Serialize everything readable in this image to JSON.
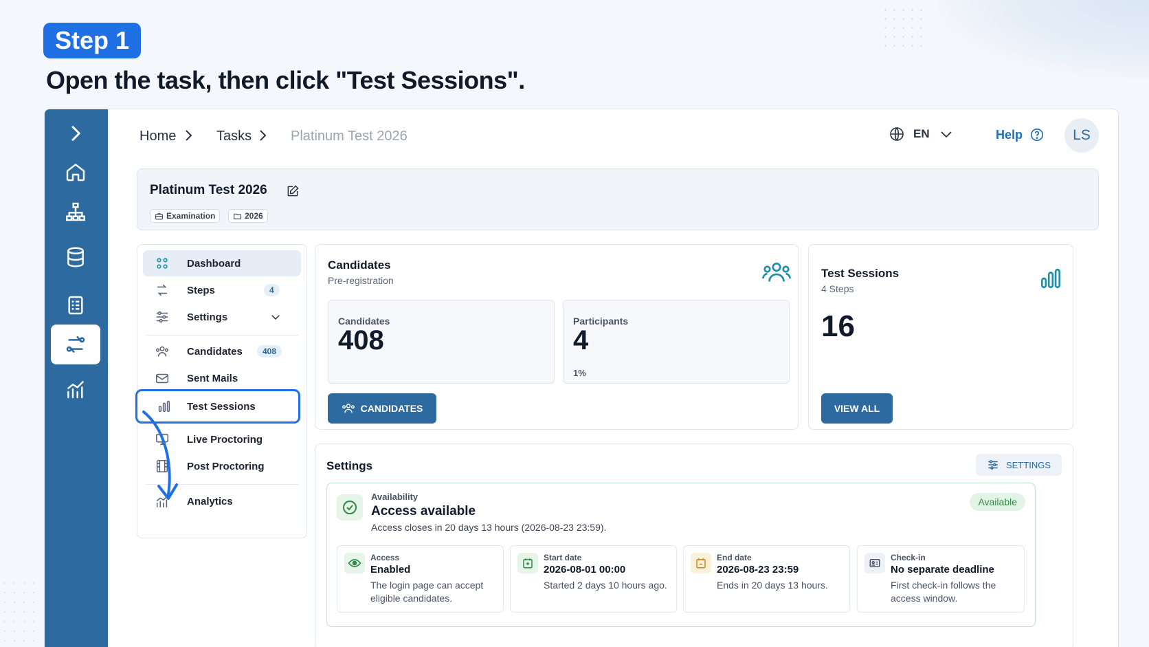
{
  "step_badge": "Step 1",
  "instruction": "Open the task, then click \"Test Sessions\".",
  "rail": {
    "icons": [
      "chevron-right-icon",
      "home-icon",
      "hierarchy-icon",
      "database-icon",
      "checklist-icon",
      "sessions-icon",
      "analytics-icon"
    ],
    "active_index": 5
  },
  "breadcrumb": {
    "home": "Home",
    "tasks": "Tasks",
    "current": "Platinum Test 2026"
  },
  "header": {
    "lang": "EN",
    "help": "Help",
    "avatar": "LS"
  },
  "task": {
    "title": "Platinum Test 2026",
    "tag_type": "Examination",
    "tag_year": "2026"
  },
  "sidebar": {
    "items": [
      {
        "label": "Dashboard",
        "icon": "dashboard-icon"
      },
      {
        "label": "Steps",
        "icon": "steps-icon",
        "badge": "4"
      },
      {
        "label": "Settings",
        "icon": "sliders-icon"
      },
      {
        "label": "Candidates",
        "icon": "users-icon",
        "badge": "408"
      },
      {
        "label": "Sent Mails",
        "icon": "mail-icon"
      },
      {
        "label": "Test Sessions",
        "icon": "bar-chart-icon"
      },
      {
        "label": "Live Proctoring",
        "icon": "monitor-icon"
      },
      {
        "label": "Post Proctoring",
        "icon": "film-icon"
      },
      {
        "label": "Analytics",
        "icon": "analytics-icon"
      }
    ]
  },
  "candidates_card": {
    "title": "Candidates",
    "subtitle": "Pre-registration",
    "stat1_label": "Candidates",
    "stat1_value": "408",
    "stat2_label": "Participants",
    "stat2_value": "4",
    "stat2_pct": "1%",
    "button": "CANDIDATES"
  },
  "sessions_card": {
    "title": "Test Sessions",
    "subtitle": "4 Steps",
    "value": "16",
    "button": "VIEW ALL"
  },
  "settings_card": {
    "title": "Settings",
    "button": "SETTINGS",
    "availability": {
      "small": "Availability",
      "title": "Access available",
      "desc": "Access closes in 20 days 13 hours (2026-08-23 23:59).",
      "pill": "Available"
    },
    "minis": [
      {
        "label": "Access",
        "value": "Enabled",
        "desc": "The login page can accept eligible candidates.",
        "color": "#2e8a44"
      },
      {
        "label": "Start date",
        "value": "2026-08-01 00:00",
        "desc": "Started 2 days 10 hours ago.",
        "color": "#2e8a44"
      },
      {
        "label": "End date",
        "value": "2026-08-23 23:59",
        "desc": "Ends in 20 days 13 hours.",
        "color": "#c58a1a"
      },
      {
        "label": "Check-in",
        "value": "No separate deadline",
        "desc": "First check-in follows the access window.",
        "color": "#4a5466"
      }
    ]
  },
  "colors": {
    "accent": "#1f6fe5",
    "rail": "#2d6aa0",
    "teal": "#1f8fa6"
  }
}
